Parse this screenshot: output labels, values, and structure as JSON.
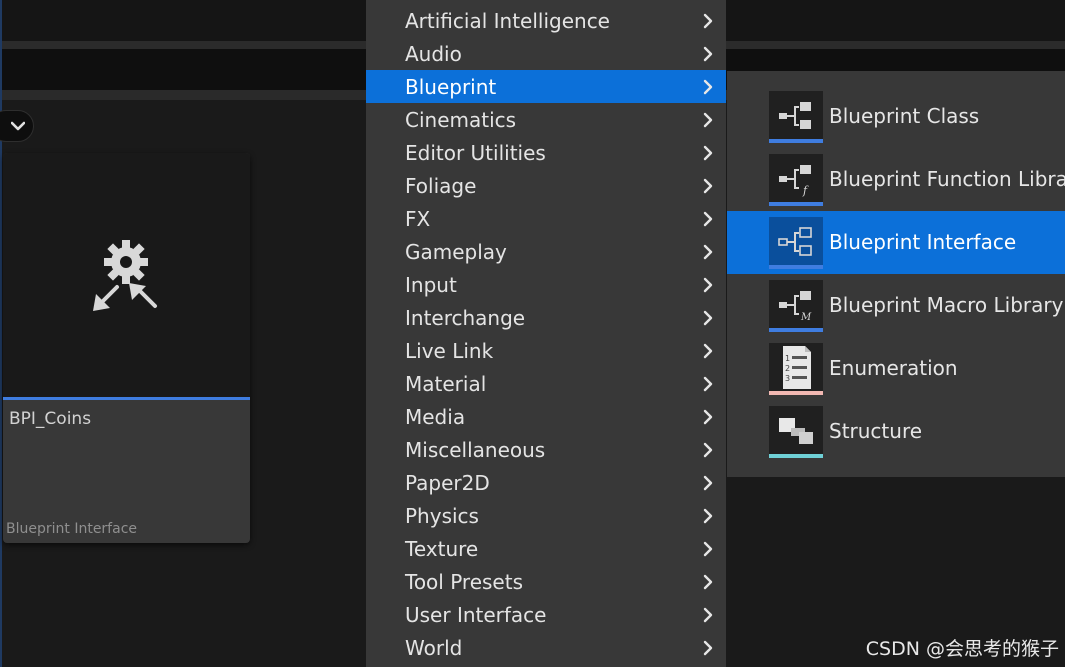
{
  "asset": {
    "name": "BPI_Coins",
    "type": "Blueprint Interface",
    "accent_color": "#3f7de0",
    "icon": "blueprint-interface-gear-arrows-icon"
  },
  "menu": {
    "items": [
      {
        "label": "Artificial Intelligence",
        "selected": false
      },
      {
        "label": "Audio",
        "selected": false
      },
      {
        "label": "Blueprint",
        "selected": true
      },
      {
        "label": "Cinematics",
        "selected": false
      },
      {
        "label": "Editor Utilities",
        "selected": false
      },
      {
        "label": "Foliage",
        "selected": false
      },
      {
        "label": "FX",
        "selected": false
      },
      {
        "label": "Gameplay",
        "selected": false
      },
      {
        "label": "Input",
        "selected": false
      },
      {
        "label": "Interchange",
        "selected": false
      },
      {
        "label": "Live Link",
        "selected": false
      },
      {
        "label": "Material",
        "selected": false
      },
      {
        "label": "Media",
        "selected": false
      },
      {
        "label": "Miscellaneous",
        "selected": false
      },
      {
        "label": "Paper2D",
        "selected": false
      },
      {
        "label": "Physics",
        "selected": false
      },
      {
        "label": "Texture",
        "selected": false
      },
      {
        "label": "Tool Presets",
        "selected": false
      },
      {
        "label": "User Interface",
        "selected": false
      },
      {
        "label": "World",
        "selected": false
      }
    ],
    "selected_color": "#0c70d9"
  },
  "submenu": {
    "items": [
      {
        "label": "Blueprint Class",
        "icon": "blueprint-class-icon",
        "color": "#3f7de0",
        "selected": false
      },
      {
        "label": "Blueprint Function Library",
        "icon": "blueprint-function-library-icon",
        "color": "#3f7de0",
        "selected": false
      },
      {
        "label": "Blueprint Interface",
        "icon": "blueprint-interface-icon",
        "color": "#3f7de0",
        "selected": true
      },
      {
        "label": "Blueprint Macro Library",
        "icon": "blueprint-macro-library-icon",
        "color": "#3f7de0",
        "selected": false
      },
      {
        "label": "Enumeration",
        "icon": "enumeration-icon",
        "color": "#f2b8b2",
        "selected": false
      },
      {
        "label": "Structure",
        "icon": "structure-icon",
        "color": "#6fd0d6",
        "selected": false
      }
    ]
  },
  "watermark": "CSDN @会思考的猴子"
}
